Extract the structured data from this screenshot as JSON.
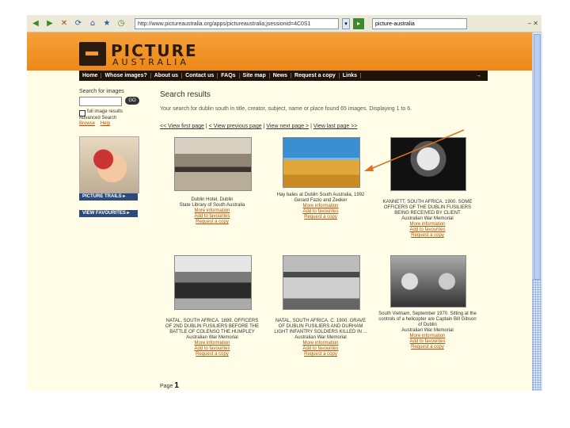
{
  "browser": {
    "address": "http://www.pictureaustralia.org/apps/pictureaustralia;jsessionid=4C0S1",
    "search": "picture-australia",
    "right_icons": "– ✕"
  },
  "logo": {
    "line1": "PICTURE",
    "line2": "AUSTRALIA"
  },
  "nav": {
    "items": [
      "Home",
      "Whose images?",
      "About us",
      "Contact us",
      "FAQs",
      "Site map",
      "News",
      "Request a copy",
      "Links"
    ],
    "arrow": "→"
  },
  "sidebar": {
    "search_label": "Search for images",
    "go_label": "GO",
    "checkbox_label": "full image results",
    "advanced_label": "Advanced Search",
    "browse": "Browse",
    "help": "Help",
    "trails_button": "PICTURE TRAILS ▸",
    "favourites_button": "VIEW FAVOURITES ▸"
  },
  "main": {
    "title": "Search results",
    "description": "Your search for dublin south in title, creator, subject, name or place found 65 images. Displaying 1 to 6.",
    "pager": [
      "<< View first page",
      "< View previous page",
      "View next page >",
      "View last page >>"
    ]
  },
  "results": [
    {
      "title": "Dublin Hotel, Dublin",
      "source": "State Library of South Australia",
      "links": [
        "More information",
        "Add to favourites",
        "Request a copy"
      ]
    },
    {
      "title": "Hay bales at Dublin South Australia, 1992",
      "source": "Gerard Fazio and Zeeker",
      "links": [
        "More information",
        "Add to favourites",
        "Request a copy"
      ]
    },
    {
      "title": "KANNETT, SOUTH AFRICA. 1900. SOME OFFICERS OF THE DUBLIN FUSILIERS BEING RECEIVED BY CLIENT",
      "source": "Australian War Memorial",
      "links": [
        "More information",
        "Add to favourites",
        "Request a copy"
      ]
    },
    {
      "title": "NATAL, SOUTH AFRICA. 1899. OFFICERS OF 2ND DUBLIN FUSILIERS BEFORE THE BATTLE OF COLENSO THE HUMPLEY",
      "source": "Australian War Memorial",
      "links": [
        "More information",
        "Add to favourites",
        "Request a copy"
      ]
    },
    {
      "title": "NATAL, SOUTH AFRICA. C. 1900. GRAVE OF DUBLIN FUSILIERS AND DURHAM LIGHT INFANTRY SOLDIERS KILLED IN ...",
      "source": "Australian War Memorial",
      "links": [
        "More information",
        "Add to favourites",
        "Request a copy"
      ]
    },
    {
      "title": "South Vietnam, September 1970. Sitting at the controls of a helicopter are Captain Bill Gibson of Dublin",
      "source": "Australian War Memorial",
      "links": [
        "More information",
        "Add to favourites",
        "Request a copy"
      ]
    }
  ],
  "footer": {
    "page_label": "Page",
    "page_number": "1"
  }
}
